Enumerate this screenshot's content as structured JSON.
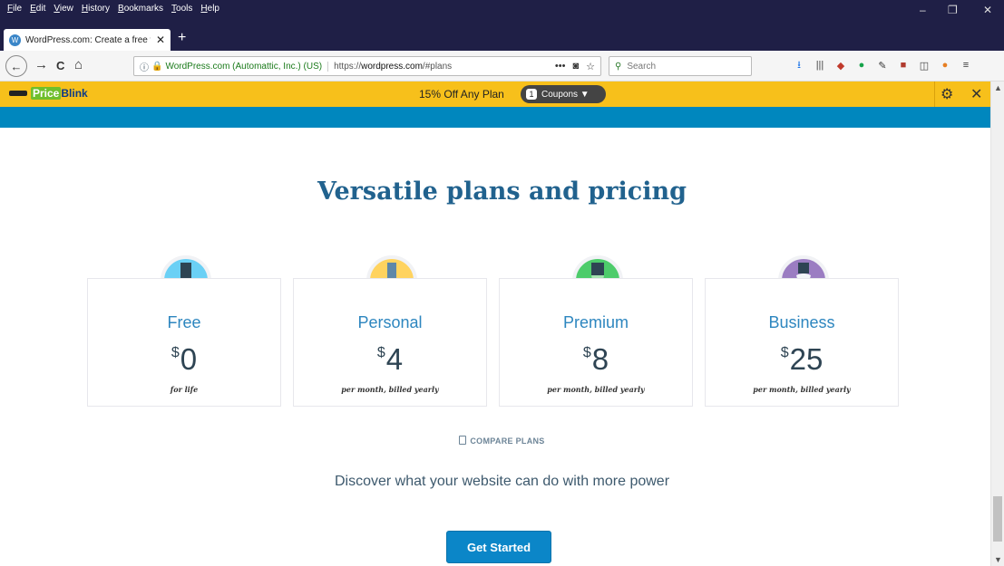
{
  "menu": [
    "File",
    "Edit",
    "View",
    "History",
    "Bookmarks",
    "Tools",
    "Help"
  ],
  "window": {
    "minimize": "–",
    "restore": "❐",
    "close": "✕"
  },
  "tab": {
    "title": "WordPress.com: Create a free w",
    "close": "✕",
    "new_tab": "+"
  },
  "nav": {
    "back": "←",
    "forward": "→",
    "reload": "C",
    "home": "⌂",
    "identity": "WordPress.com (Automattic, Inc.) (US)",
    "url_prefix": "https://",
    "url_host": "wordpress.com",
    "url_path": "/#plans",
    "search_placeholder": "Search"
  },
  "priceblink": {
    "logo_price": "Price",
    "logo_blink": "Blink",
    "offer": "15% Off Any Plan",
    "coupon_count": "1",
    "coupon_label": "Coupons ▼"
  },
  "main": {
    "heading": "Versatile plans and pricing",
    "plans": [
      {
        "name": "Free",
        "currency": "$",
        "price": "0",
        "note": "for life",
        "color": "#6ad0f5"
      },
      {
        "name": "Personal",
        "currency": "$",
        "price": "4",
        "note": "per month, billed yearly",
        "color": "#ffd35f"
      },
      {
        "name": "Premium",
        "currency": "$",
        "price": "8",
        "note": "per month, billed yearly",
        "color": "#4dcc6b"
      },
      {
        "name": "Business",
        "currency": "$",
        "price": "25",
        "note": "per month, billed yearly",
        "color": "#9b7dc2"
      }
    ],
    "compare": "COMPARE PLANS",
    "discover": "Discover what your website can do with more power",
    "cta": "Get Started"
  }
}
